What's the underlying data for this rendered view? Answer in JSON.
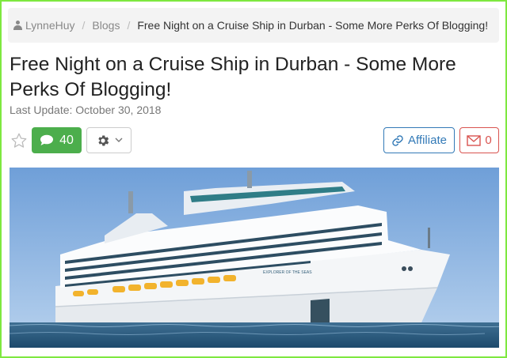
{
  "breadcrumb": {
    "user": "LynneHuy",
    "section": "Blogs",
    "current": "Free Night on a Cruise Ship in Durban - Some More Perks Of Blogging!",
    "separator": "/"
  },
  "post": {
    "title": "Free Night on a Cruise Ship in Durban - Some More Perks Of Blogging!",
    "last_update": "Last Update: October 30, 2018"
  },
  "actions": {
    "comments_count": "40",
    "affiliate_label": "Affiliate",
    "mail_count": "0"
  },
  "hero": {
    "ship_name": "EXPLORER OF THE SEAS"
  },
  "colors": {
    "frame": "#7ee83f",
    "success": "#4cae4c",
    "primary": "#337ab7",
    "danger": "#d9534f"
  },
  "icons": [
    "user-icon",
    "star-icon",
    "comment-icon",
    "gear-icon",
    "chevron-down-icon",
    "link-icon",
    "envelope-icon"
  ]
}
